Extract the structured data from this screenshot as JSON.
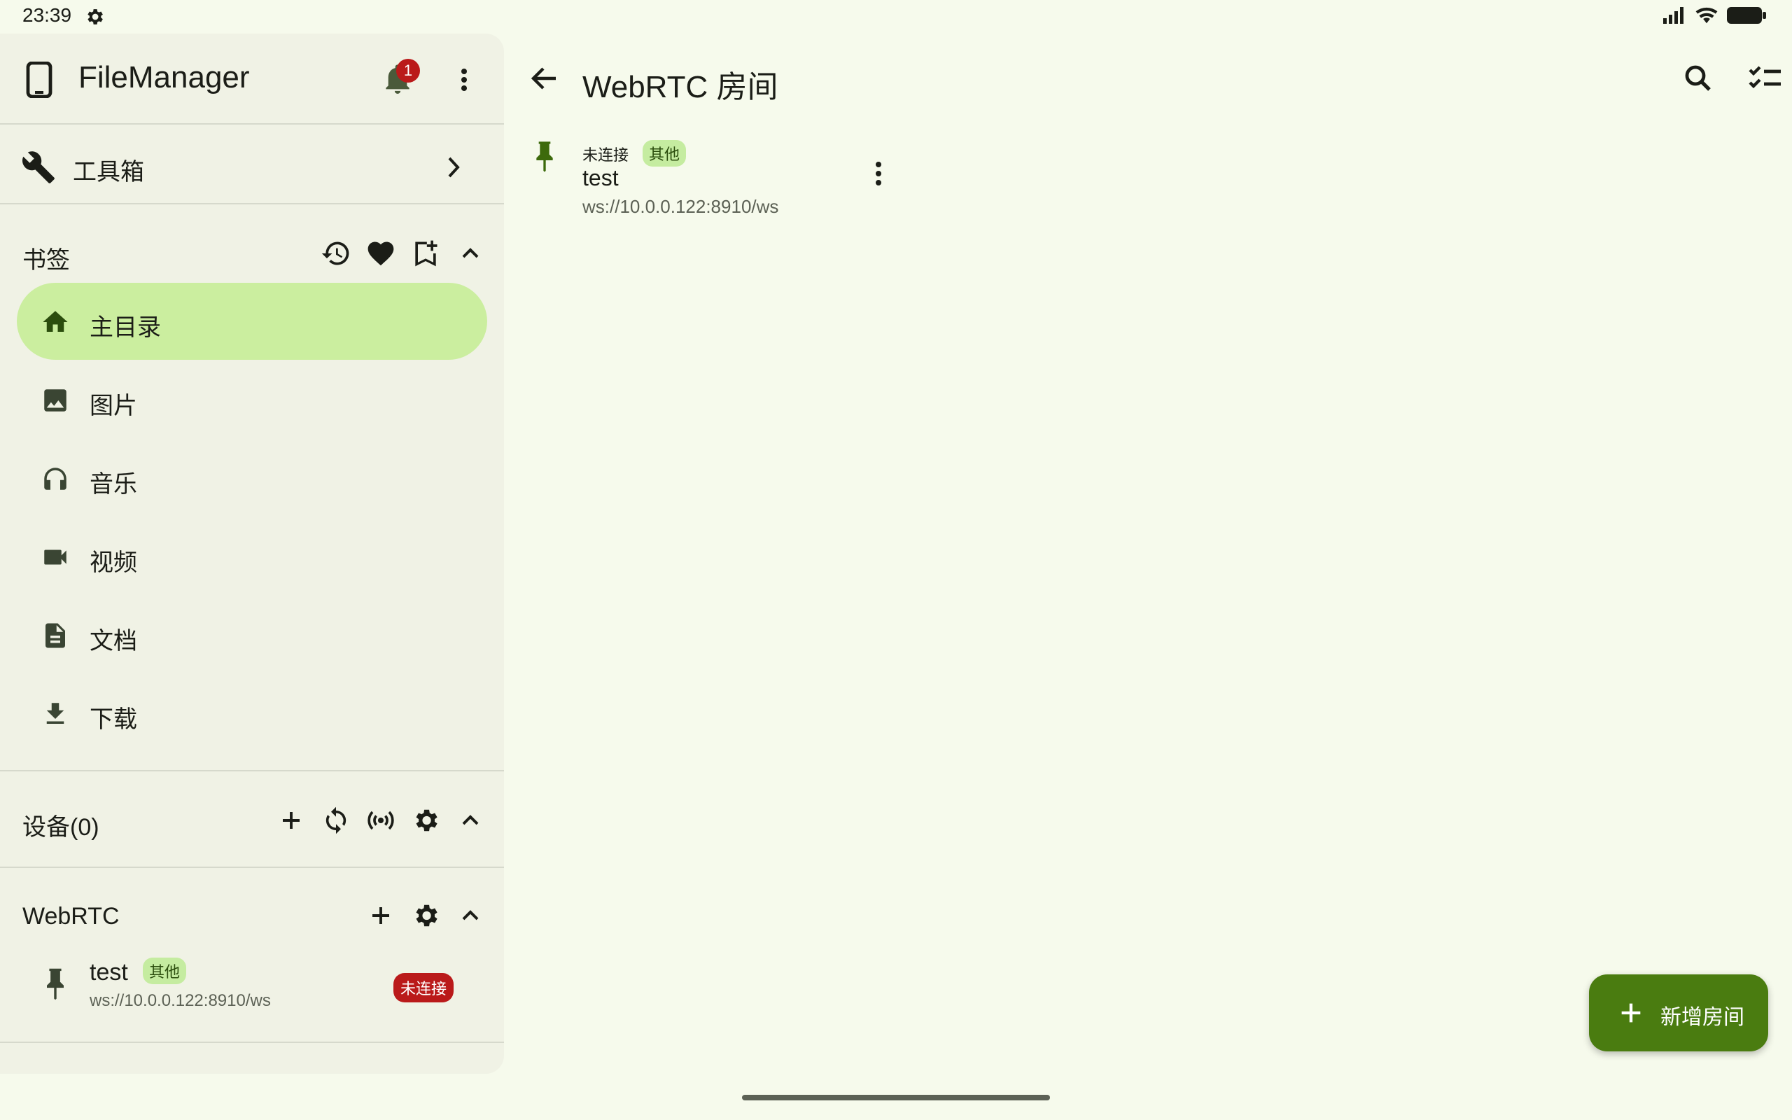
{
  "status_bar": {
    "time": "23:39",
    "icons": [
      "settings-icon",
      "signal-icon",
      "wifi-icon",
      "battery-icon"
    ]
  },
  "drawer": {
    "app_title": "FileManager",
    "notification_count": "1",
    "toolbox_label": "工具箱",
    "bookmarks": {
      "label": "书签",
      "icons": [
        "history-icon",
        "heart-icon",
        "bookmark-add-icon",
        "chevron-up-icon"
      ],
      "items": [
        {
          "label": "主目录",
          "icon": "home-icon",
          "active": true
        },
        {
          "label": "图片",
          "icon": "image-icon"
        },
        {
          "label": "音乐",
          "icon": "headphones-icon"
        },
        {
          "label": "视频",
          "icon": "videocam-icon"
        },
        {
          "label": "文档",
          "icon": "document-icon"
        },
        {
          "label": "下载",
          "icon": "download-icon"
        }
      ]
    },
    "devices": {
      "label": "设备(0)",
      "icons": [
        "add-icon",
        "sync-icon",
        "broadcast-icon",
        "settings-icon",
        "chevron-up-icon"
      ]
    },
    "webrtc": {
      "label": "WebRTC",
      "icons": [
        "add-icon",
        "settings-icon",
        "chevron-up-icon"
      ],
      "item": {
        "name": "test",
        "tag": "其他",
        "url": "ws://10.0.0.122:8910/ws",
        "status": "未连接"
      }
    }
  },
  "main": {
    "title": "WebRTC 房间",
    "rooms": [
      {
        "status": "未连接",
        "tag": "其他",
        "name": "test",
        "url": "ws://10.0.0.122:8910/ws"
      }
    ],
    "fab_label": "新增房间"
  },
  "colors": {
    "background": "#f6faec",
    "drawer": "#f0f2e5",
    "active_nav": "#cbee9f",
    "accent": "#4a7c10",
    "tag_bg": "#c5eca0",
    "error": "#ba1a1a"
  }
}
